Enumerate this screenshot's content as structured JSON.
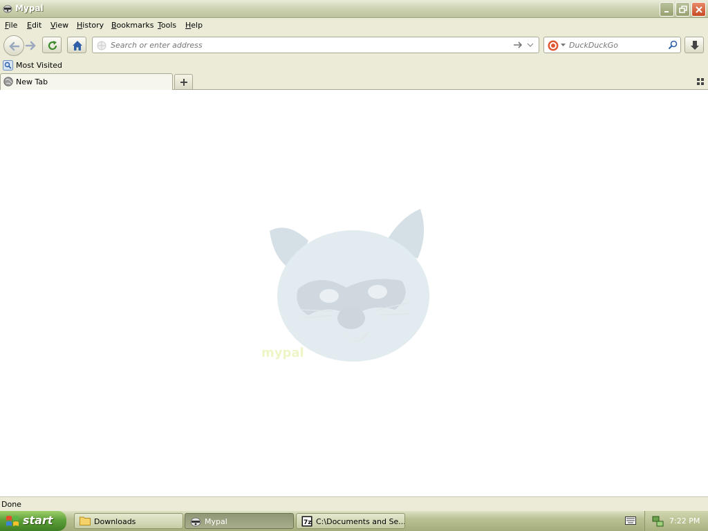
{
  "window": {
    "title": "Mypal",
    "app_icon": "raccoon-icon"
  },
  "menu": [
    "File",
    "Edit",
    "View",
    "History",
    "Bookmarks",
    "Tools",
    "Help"
  ],
  "nav": {
    "url_placeholder": "Search or enter address",
    "search_engine": "DuckDuckGo"
  },
  "bookmarks": {
    "items": [
      {
        "label": "Most Visited",
        "icon": "bookmark-folder-icon"
      }
    ]
  },
  "tabs": [
    {
      "label": "New Tab",
      "icon": "globe-icon"
    }
  ],
  "content": {
    "logo_text": "mypal"
  },
  "status": {
    "text": "Done"
  },
  "taskbar": {
    "start_label": "start",
    "items": [
      {
        "label": "Downloads",
        "icon": "folder-icon",
        "active": false
      },
      {
        "label": "Mypal",
        "icon": "raccoon-icon",
        "active": true
      },
      {
        "label": "C:\\Documents and Se...",
        "icon": "7zip-icon",
        "active": false
      }
    ],
    "clock": "7:22 PM"
  },
  "colors": {
    "window_chrome": "#ecebd8",
    "titlebar": "#bcc29b",
    "start_button": "#5ea03a"
  }
}
